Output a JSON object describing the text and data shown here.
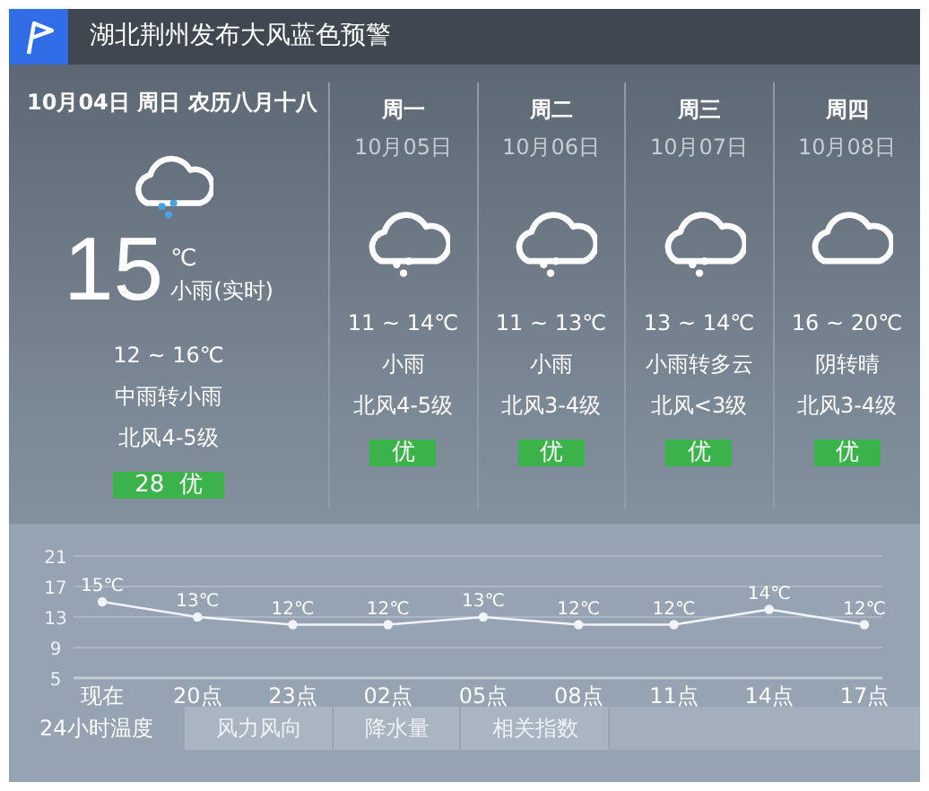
{
  "alert": {
    "title": "湖北荆州发布大风蓝色预警"
  },
  "today": {
    "date_line": "10月04日 周日 农历八月十八",
    "kind": "rain",
    "temp": "15",
    "unit": "℃",
    "condition": "小雨(实时)",
    "range": "12 ~ 16℃",
    "weather": "中雨转小雨",
    "wind": "北风4-5级",
    "aqi": "28  优"
  },
  "days": [
    {
      "weekday": "周一",
      "date": "10月05日",
      "kind": "rain",
      "range": "11 ~ 14℃",
      "weather": "小雨",
      "wind": "北风4-5级",
      "aqi": "优"
    },
    {
      "weekday": "周二",
      "date": "10月06日",
      "kind": "rain",
      "range": "11 ~ 13℃",
      "weather": "小雨",
      "wind": "北风3-4级",
      "aqi": "优"
    },
    {
      "weekday": "周三",
      "date": "10月07日",
      "kind": "rain",
      "range": "13 ~ 14℃",
      "weather": "小雨转多云",
      "wind": "北风<3级",
      "aqi": "优"
    },
    {
      "weekday": "周四",
      "date": "10月08日",
      "kind": "cloud",
      "range": "16 ~ 20℃",
      "weather": "阴转晴",
      "wind": "北风3-4级",
      "aqi": "优"
    }
  ],
  "hourly": {
    "chart_data": {
      "type": "line",
      "grid": true,
      "categories": [
        "现在",
        "20点",
        "23点",
        "02点",
        "05点",
        "08点",
        "11点",
        "14点",
        "17点"
      ],
      "series": [
        {
          "color": "#f2f5f8",
          "marker": true,
          "values": [
            15,
            13,
            12,
            12,
            13,
            12,
            12,
            14,
            12
          ]
        }
      ],
      "ylim": [
        5,
        21
      ],
      "yticks": [
        5,
        9,
        13,
        17,
        21
      ],
      "value_labels": [
        "15℃",
        "13℃",
        "12℃",
        "12℃",
        "13℃",
        "12℃",
        "12℃",
        "14℃",
        "12℃"
      ]
    }
  },
  "tabs": [
    {
      "label": "24小时温度",
      "selected": true
    },
    {
      "label": "风力风向",
      "selected": false
    },
    {
      "label": "降水量",
      "selected": false
    },
    {
      "label": "相关指数",
      "selected": false
    }
  ]
}
